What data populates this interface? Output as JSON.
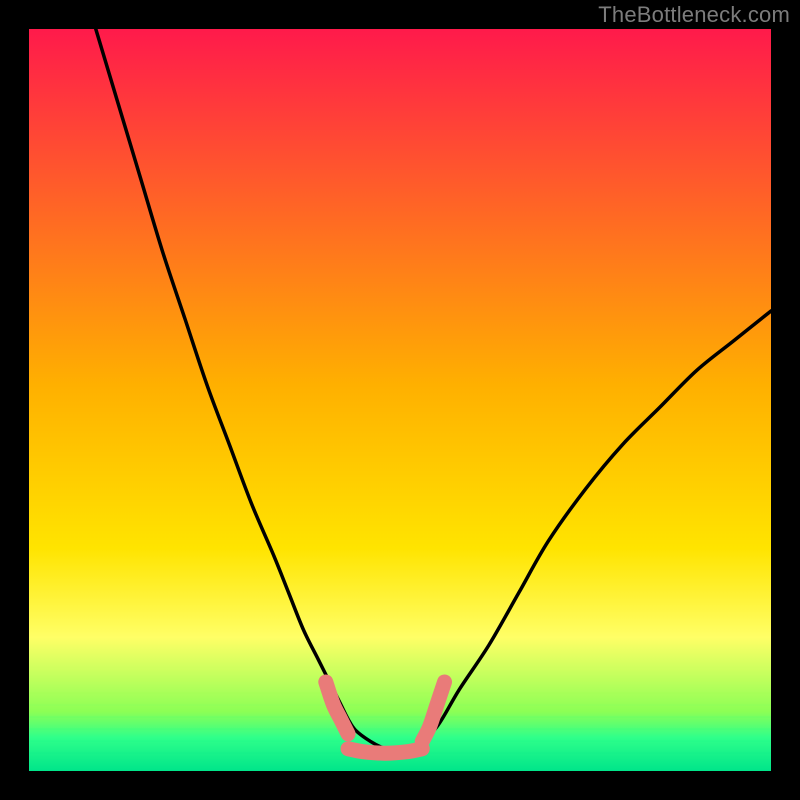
{
  "watermark": {
    "text": "TheBottleneck.com"
  },
  "colors": {
    "frame": "#000000",
    "gradient_top": "#ff1a4b",
    "gradient_mid": "#ffe400",
    "gradient_green1": "#9cff5a",
    "gradient_green2": "#2fff8a",
    "gradient_bottom": "#00e58a",
    "curve": "#000000",
    "highlight": "#e97b79"
  },
  "chart_data": {
    "type": "line",
    "title": "",
    "xlabel": "",
    "ylabel": "",
    "xlim": [
      0,
      100
    ],
    "ylim": [
      0,
      100
    ],
    "series": [
      {
        "name": "bottleneck-curve",
        "x": [
          9,
          12,
          15,
          18,
          21,
          24,
          27,
          30,
          33,
          35,
          37,
          39,
          41,
          42,
          43,
          44,
          46,
          48,
          50,
          52,
          55,
          58,
          62,
          66,
          70,
          75,
          80,
          85,
          90,
          95,
          100
        ],
        "y": [
          100,
          90,
          80,
          70,
          61,
          52,
          44,
          36,
          29,
          24,
          19,
          15,
          11,
          9,
          7,
          5.5,
          4,
          3,
          2.6,
          3,
          6,
          11,
          17,
          24,
          31,
          38,
          44,
          49,
          54,
          58,
          62
        ]
      }
    ],
    "highlight_segments": [
      {
        "x": [
          40,
          41,
          42,
          43
        ],
        "y": [
          12,
          9,
          7,
          5
        ]
      },
      {
        "x": [
          43,
          45,
          48,
          51,
          53
        ],
        "y": [
          3,
          2.6,
          2.4,
          2.6,
          3
        ]
      },
      {
        "x": [
          53,
          54,
          55,
          56
        ],
        "y": [
          4,
          6,
          9,
          12
        ]
      }
    ],
    "background_gradient_stops": [
      {
        "offset": 0.0,
        "color": "#ff1a4b"
      },
      {
        "offset": 0.48,
        "color": "#ffb000"
      },
      {
        "offset": 0.7,
        "color": "#ffe400"
      },
      {
        "offset": 0.82,
        "color": "#ffff66"
      },
      {
        "offset": 0.92,
        "color": "#8cff55"
      },
      {
        "offset": 0.955,
        "color": "#2fff8a"
      },
      {
        "offset": 1.0,
        "color": "#00e58a"
      }
    ]
  }
}
